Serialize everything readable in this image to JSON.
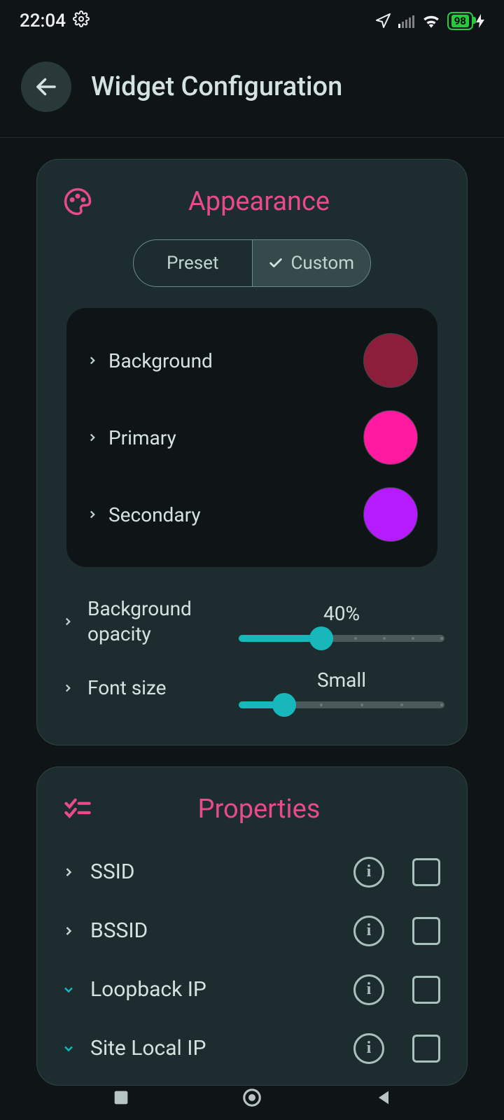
{
  "status": {
    "time": "22:04",
    "battery": "98"
  },
  "header": {
    "title": "Widget Configuration"
  },
  "appearance": {
    "title": "Appearance",
    "tabs": {
      "preset": "Preset",
      "custom": "Custom",
      "selected": "custom"
    },
    "colors": {
      "background": {
        "label": "Background",
        "hex": "#8c1e3b"
      },
      "primary": {
        "label": "Primary",
        "hex": "#ff1aa0"
      },
      "secondary": {
        "label": "Secondary",
        "hex": "#b61bff"
      }
    },
    "opacity": {
      "label": "Background opacity",
      "value_text": "40%",
      "percent": 40
    },
    "font_size": {
      "label": "Font size",
      "value_text": "Small",
      "percent": 22
    }
  },
  "properties": {
    "title": "Properties",
    "items": [
      {
        "label": "SSID",
        "expandable": true,
        "expanded": false,
        "checked": false
      },
      {
        "label": "BSSID",
        "expandable": true,
        "expanded": false,
        "checked": false
      },
      {
        "label": "Loopback IP",
        "expandable": true,
        "expanded": true,
        "checked": false
      },
      {
        "label": "Site Local IP",
        "expandable": true,
        "expanded": true,
        "checked": false
      }
    ]
  }
}
